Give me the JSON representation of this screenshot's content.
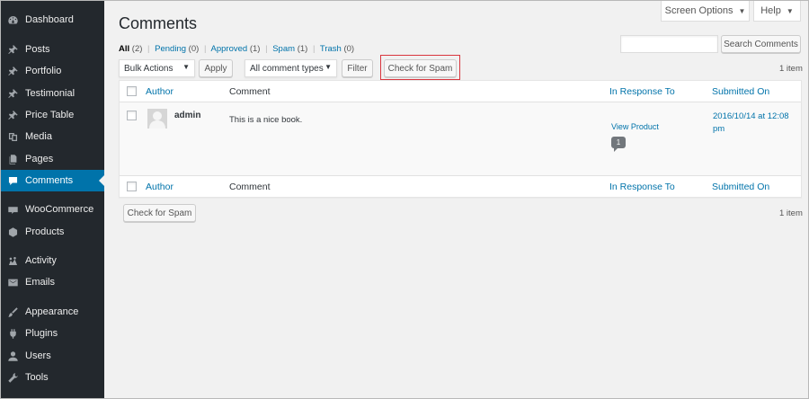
{
  "sidebar": {
    "items": [
      {
        "label": "Dashboard",
        "icon": "dashboard-icon"
      },
      {
        "label": "Posts",
        "icon": "pin-icon"
      },
      {
        "label": "Portfolio",
        "icon": "pin-icon"
      },
      {
        "label": "Testimonial",
        "icon": "pin-icon"
      },
      {
        "label": "Price Table",
        "icon": "pin-icon"
      },
      {
        "label": "Media",
        "icon": "media-icon"
      },
      {
        "label": "Pages",
        "icon": "pages-icon"
      },
      {
        "label": "Comments",
        "icon": "comment-icon"
      },
      {
        "label": "WooCommerce",
        "icon": "woocommerce-icon"
      },
      {
        "label": "Products",
        "icon": "products-icon"
      },
      {
        "label": "Activity",
        "icon": "activity-icon"
      },
      {
        "label": "Emails",
        "icon": "email-icon"
      },
      {
        "label": "Appearance",
        "icon": "brush-icon"
      },
      {
        "label": "Plugins",
        "icon": "plugin-icon"
      },
      {
        "label": "Users",
        "icon": "users-icon"
      },
      {
        "label": "Tools",
        "icon": "wrench-icon"
      }
    ],
    "active": "Comments",
    "colors": {
      "bg": "#23282d",
      "active": "#0073aa"
    }
  },
  "header": {
    "screen_options": "Screen Options",
    "help": "Help",
    "title": "Comments"
  },
  "filters": {
    "all": {
      "label": "All",
      "count": "(2)"
    },
    "pending": {
      "label": "Pending",
      "count": "(0)"
    },
    "approved": {
      "label": "Approved",
      "count": "(1)"
    },
    "spam": {
      "label": "Spam",
      "count": "(1)"
    },
    "trash": {
      "label": "Trash",
      "count": "(0)"
    },
    "separator": "|"
  },
  "search": {
    "value": "",
    "button": "Search Comments"
  },
  "toolbar": {
    "bulk_actions": "Bulk Actions",
    "apply": "Apply",
    "comment_types": "All comment types",
    "filter": "Filter",
    "check_spam": "Check for Spam",
    "items_count": "1 item"
  },
  "table": {
    "columns": {
      "author": "Author",
      "comment": "Comment",
      "in_response_to": "In Response To",
      "submitted_on": "Submitted On"
    },
    "rows": [
      {
        "author": "admin",
        "comment": "This is a nice book.",
        "response_link": "View Product",
        "response_count": "1",
        "submitted": "2016/10/14 at 12:08 pm"
      }
    ]
  },
  "bottom": {
    "check_spam": "Check for Spam",
    "items_count": "1 item"
  }
}
